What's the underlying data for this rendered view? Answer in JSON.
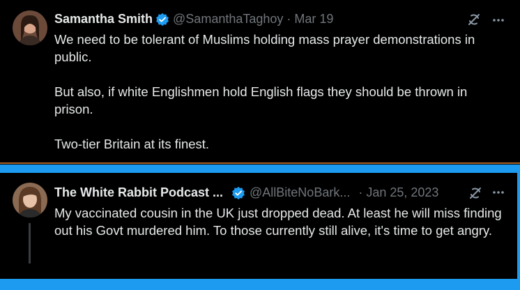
{
  "tweet1": {
    "display_name": "Samantha Smith",
    "handle": "@SamanthaTaghoy",
    "separator": "·",
    "date": "Mar 19",
    "text": "We need to be tolerant of Muslims holding mass prayer demonstrations in public.\n\nBut also, if white Englishmen hold English flags they should be thrown in prison.\n\nTwo-tier Britain at its finest.",
    "verified": true
  },
  "tweet2": {
    "display_name": "The White Rabbit Podcast ...",
    "handle": "@AllBiteNoBark...",
    "separator": "·",
    "date": "Jan 25, 2023",
    "text": "My vaccinated cousin in the UK just dropped dead. At least he will miss finding out his Govt murdered him. To those currently still alive, it's time to get angry.",
    "verified": true
  },
  "colors": {
    "accent": "#1d9bf0",
    "text": "#e7e9ea",
    "muted": "#71767b",
    "background": "#000000"
  },
  "icons": {
    "verified": "verified-badge-icon",
    "grok": "grok-icon",
    "more": "more-icon"
  }
}
